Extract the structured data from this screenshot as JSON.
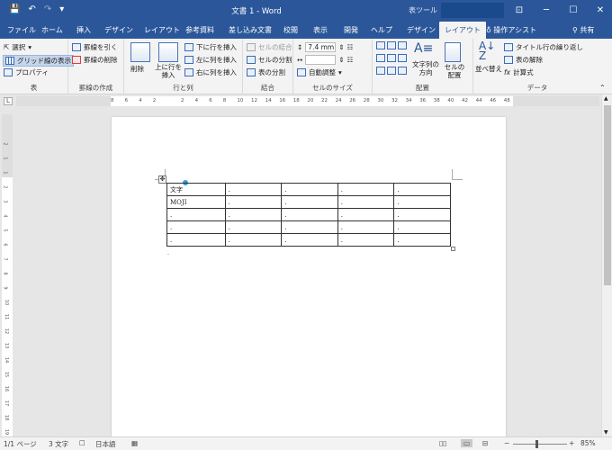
{
  "window": {
    "doc_title": "文書 1 - Word",
    "context_tab": "表ツール"
  },
  "qat": {
    "save": "💾",
    "undo": "↶",
    "redo": "↷",
    "more": "▾"
  },
  "wincontrols": {
    "restore": "⊡",
    "minimize": "─",
    "maximize": "☐",
    "close": "✕"
  },
  "tabs": [
    "ファイル",
    "ホーム",
    "挿入",
    "デザイン",
    "レイアウト",
    "参考資料",
    "差し込み文書",
    "校閲",
    "表示",
    "開発",
    "ヘルプ",
    "デザイン",
    "レイアウト"
  ],
  "tell_me": "操作アシスト",
  "share": "共有",
  "ribbon": {
    "table_group": {
      "label": "表",
      "select": "選択",
      "gridlines": "グリッド線の表示",
      "properties": "プロパティ"
    },
    "draw_group": {
      "label": "罫線の作成",
      "draw": "罫線を引く",
      "erase": "罫線の削除"
    },
    "rows_group": {
      "label": "行と列",
      "delete": "削除",
      "insert_above": "上に行を挿入",
      "insert_below": "下に行を挿入",
      "insert_left": "左に列を挿入",
      "insert_right": "右に列を挿入"
    },
    "merge_group": {
      "label": "結合",
      "merge": "セルの結合",
      "split_cells": "セルの分割",
      "split_table": "表の分割"
    },
    "size_group": {
      "label": "セルのサイズ",
      "height": "7.4 mm",
      "autofit": "自動調整"
    },
    "align_group": {
      "label": "配置",
      "direction": "文字列の方向",
      "margins": "セルの配置"
    },
    "data_group": {
      "label": "データ",
      "sort": "並べ替え",
      "repeat_header": "タイトル行の繰り返し",
      "convert": "表の解除",
      "formula": "計算式"
    }
  },
  "ruler": {
    "ticks": [
      "8",
      "6",
      "4",
      "2",
      "",
      "2",
      "4",
      "6",
      "8",
      "10",
      "12",
      "14",
      "16",
      "18",
      "20",
      "22",
      "24",
      "26",
      "28",
      "30",
      "32",
      "34",
      "36",
      "38",
      "40",
      "42",
      "44",
      "46",
      "48"
    ],
    "vticks": [
      "2",
      "1",
      "1",
      "2",
      "3",
      "4",
      "5",
      "6",
      "7",
      "8",
      "9",
      "10",
      "11",
      "12",
      "13",
      "14",
      "15",
      "16",
      "17",
      "18",
      "19",
      "20"
    ],
    "tab_marker": "L"
  },
  "table": {
    "rows": [
      [
        "文字",
        "",
        "",
        "",
        ""
      ],
      [
        "MOJI",
        "",
        "",
        "",
        ""
      ],
      [
        "",
        "",
        "",
        "",
        ""
      ],
      [
        "",
        "",
        "",
        "",
        ""
      ],
      [
        "",
        "",
        "",
        "",
        ""
      ]
    ],
    "cell_mark": "."
  },
  "status": {
    "page": "1/1 ページ",
    "words": "3 文字",
    "lang": "日本語",
    "zoom": "85%"
  }
}
